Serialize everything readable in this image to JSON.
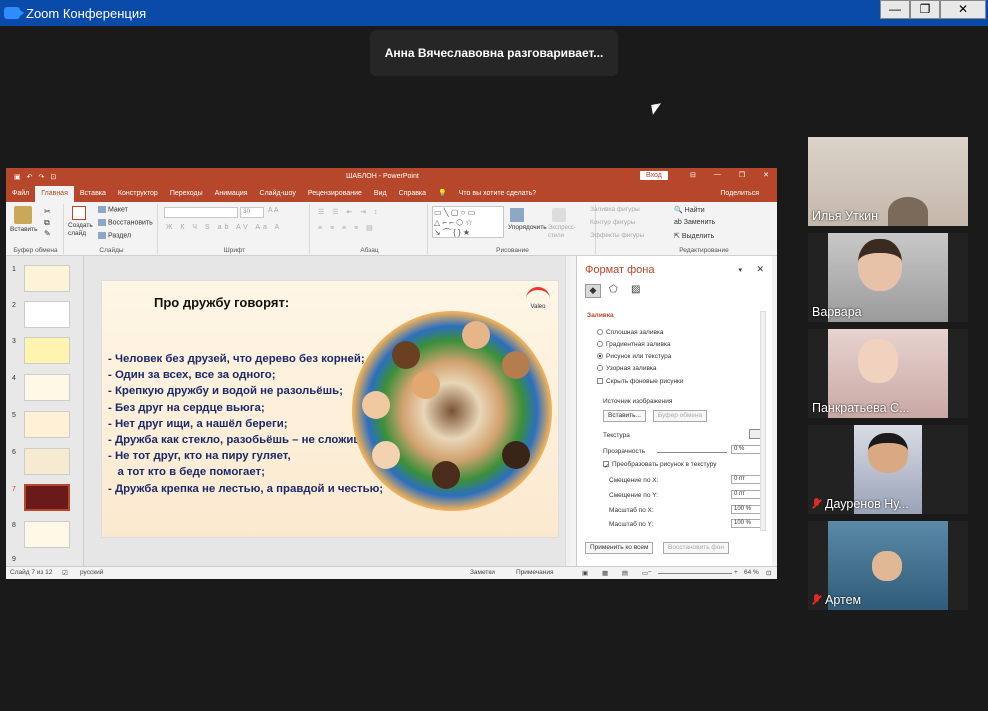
{
  "zoom": {
    "title": "Zoom Конференция",
    "speaking_banner": "Анна Вячеславовна разговаривает...",
    "win_min": "—",
    "win_max": "❐",
    "win_close": "✕"
  },
  "ppt": {
    "doc_title": "ШАБЛОН - PowerPoint",
    "signin": "Вход",
    "menu": [
      "Файл",
      "Главная",
      "Вставка",
      "Конструктор",
      "Переходы",
      "Анимация",
      "Слайд-шоу",
      "Рецензирование",
      "Вид",
      "Справка"
    ],
    "tell_me": "Что вы хотите сделать?",
    "share": "Поделиться",
    "ribbon": {
      "paste": "Вставить",
      "clipboard": "Буфер обмена",
      "new_slide": "Создать слайд",
      "layout": "Макет",
      "reset": "Восстановить",
      "section": "Раздел",
      "slides": "Слайды",
      "font": "Шрифт",
      "font_size": "30",
      "paragraph": "Абзац",
      "arrange": "Упорядочить",
      "express": "Экспресс-стили",
      "drawing": "Рисование",
      "shape_fill": "Заливка фигуры",
      "shape_outline": "Контур фигуры",
      "shape_effects": "Эффекты фигуры",
      "find": "Найти",
      "replace": "Заменить",
      "select": "Выделить",
      "editing": "Редактирование"
    },
    "thumbs": [
      "1",
      "2",
      "3",
      "4",
      "5",
      "6",
      "7",
      "8",
      "9"
    ],
    "selected_thumb": 7,
    "slide": {
      "title": "Про дружбу говорят:",
      "logo": "Valeo",
      "lines": [
        "- Человек без друзей, что дерево без корней;",
        "- Один за всех, все за одного;",
        "- Крепкую дружбу и водой не разольёшь;",
        "- Без друг на сердце вьюга;",
        "- Нет друг ищи, а нашёл береги;",
        "- Дружба как стекло, разобьёшь – не сложишь;",
        "- Не тот друг, кто на пиру гуляет,",
        "   а тот кто в беде помогает;",
        "- Дружба крепка не лестью, а правдой и честью;"
      ]
    },
    "format_pane": {
      "title": "Формат фона",
      "section": "Заливка",
      "options": [
        "Сплошная заливка",
        "Градиентная заливка",
        "Рисунок или текстура",
        "Узорная заливка"
      ],
      "selected_option": 2,
      "hide_bg": "Скрыть фоновые рисунки",
      "source": "Источник изображения",
      "insert_btn": "Вставить...",
      "clipboard_btn": "Буфер обмена",
      "texture": "Текстура",
      "transparency": "Прозрачность",
      "transparency_val": "0 %",
      "tile": "Преобразовать рисунок в текстуру",
      "offset_x": "Смещение по X:",
      "offset_x_val": "0 пт",
      "offset_y": "Смещение по Y:",
      "offset_y_val": "0 пт",
      "scale_x": "Масштаб по X:",
      "scale_x_val": "100 %",
      "scale_y": "Масштаб по Y:",
      "scale_y_val": "100 %",
      "apply_all": "Применить ко всем",
      "reset_bg": "Восстановить фон"
    },
    "status": {
      "slide_num": "Слайд 7 из 12",
      "lang": "русский",
      "notes": "Заметки",
      "comments": "Примечания",
      "zoom": "64 %"
    }
  },
  "participants": [
    {
      "name": "Илья Уткин",
      "muted": false
    },
    {
      "name": "Варвара",
      "muted": false
    },
    {
      "name": "Панкратьева С...",
      "muted": false
    },
    {
      "name": "Дауренов Ну...",
      "muted": true
    },
    {
      "name": "Артем",
      "muted": true
    }
  ],
  "colors": {
    "ppt_accent": "#b7472a",
    "zoom_title": "#0a4aa8"
  }
}
